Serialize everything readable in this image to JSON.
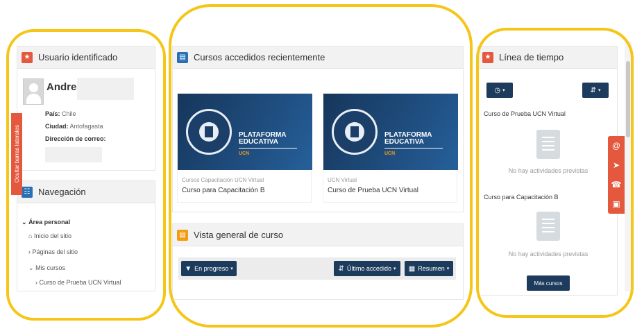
{
  "left": {
    "user_block": {
      "title": "Usuario identificado",
      "name": "Andrea",
      "country_label": "País:",
      "country_value": "Chile",
      "city_label": "Ciudad:",
      "city_value": "Antofagasta",
      "email_label": "Dirección de correo:"
    },
    "nav_block": {
      "title": "Navegación",
      "items": [
        {
          "label": "Área personal"
        },
        {
          "label": "Inicio del sitio"
        },
        {
          "label": "Páginas del sitio"
        },
        {
          "label": "Mis cursos"
        },
        {
          "label": "Curso de Prueba UCN Virtual"
        }
      ]
    },
    "side_tab_label": "Ocultar barras laterales"
  },
  "middle": {
    "recent": {
      "title": "Cursos accedidos recientemente",
      "courses": [
        {
          "category": "Cursos Capacitación UCN Virtual",
          "name": "Curso para Capacitación B",
          "banner_line1": "PLATAFORMA",
          "banner_line2": "EDUCATIVA",
          "banner_tag": "UCN"
        },
        {
          "category": "UCN Virtual",
          "name": "Curso de Prueba UCN Virtual",
          "banner_line1": "PLATAFORMA",
          "banner_line2": "EDUCATIVA",
          "banner_tag": "UCN"
        }
      ]
    },
    "overview": {
      "title": "Vista general de curso",
      "filter_label": "En progreso",
      "sort_label": "Último accedido",
      "view_label": "Resumen"
    }
  },
  "right": {
    "timeline": {
      "title": "Línea de tiempo",
      "courses": [
        {
          "name": "Curso de Prueba UCN Virtual",
          "empty": "No hay actividades previstas"
        },
        {
          "name": "Curso para Capacitación B",
          "empty": "No hay actividades previstas"
        }
      ],
      "more_label": "Más cursos"
    }
  },
  "colors": {
    "accent_red": "#e4583e",
    "accent_blue": "#2a6fb6",
    "accent_orange": "#f39c12",
    "button_dark": "#1d3b5c",
    "highlight_ring": "#f5c518"
  },
  "icons": {
    "pin": "pin-icon",
    "sitemap": "sitemap-icon",
    "course": "course-icon",
    "clock": "clock-icon",
    "sort": "sort-icon",
    "filter": "filter-icon",
    "grid": "grid-icon",
    "home": "home-icon",
    "at": "at-icon",
    "send": "send-icon",
    "phone": "phone-icon",
    "lock": "lock-icon"
  }
}
